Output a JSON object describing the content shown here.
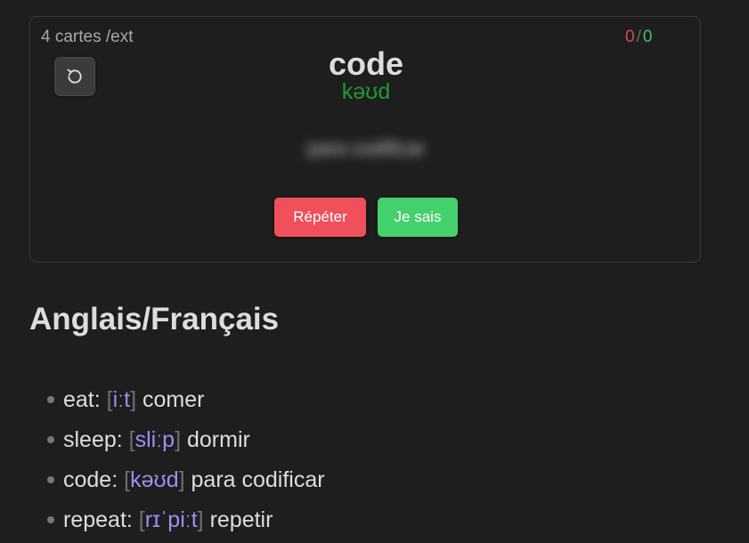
{
  "card": {
    "deck_info": "4 cartes /ext",
    "score": {
      "wrong": "0",
      "separator": "/",
      "right": "0"
    },
    "word": "code",
    "phonetic": "kəʊd",
    "hidden_translation": "para codificar",
    "reset_icon": "reset-icon",
    "buttons": {
      "repeat": "Répéter",
      "know": "Je sais"
    },
    "colors": {
      "repeat_button": "#f0505a",
      "know_button": "#45d06e",
      "phonetic": "#1e9a2e",
      "wrong_score": "#e0474c",
      "right_score": "#3fc06a"
    }
  },
  "section": {
    "title": "Anglais/Français"
  },
  "vocab": [
    {
      "word": "eat",
      "ipa": "iːt",
      "translation": "comer"
    },
    {
      "word": "sleep",
      "ipa": "sliːp",
      "translation": "dormir"
    },
    {
      "word": "code",
      "ipa": "kəʊd",
      "translation": "para codificar"
    },
    {
      "word": "repeat",
      "ipa": "rɪˈpiːt",
      "translation": "repetir"
    }
  ],
  "ipa_color": "#a08cf0"
}
